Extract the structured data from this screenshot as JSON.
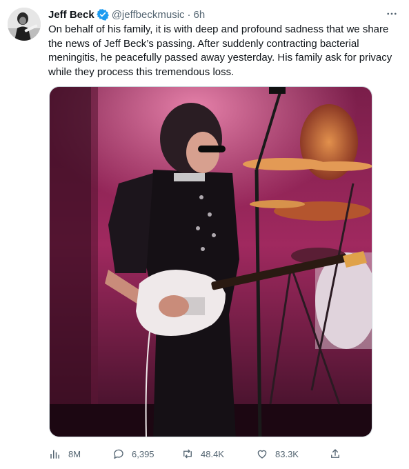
{
  "tweet": {
    "author_name": "Jeff Beck",
    "handle": "@jeffbeckmusic",
    "separator": "·",
    "time": "6h",
    "text": "On behalf of his family, it is with deep and profound sadness that we share the news of Jeff Beck’s passing. After suddenly contracting bacterial meningitis, he peacefully passed away yesterday. His family ask for privacy while they process this tremendous loss."
  },
  "icons": {
    "verified": "verified-badge-icon",
    "more": "more-options-icon",
    "views": "views-chart-icon",
    "reply": "reply-bubble-icon",
    "retweet": "retweet-icon",
    "like": "heart-icon",
    "share": "share-icon"
  },
  "actions": {
    "views": "8M",
    "replies": "6,395",
    "retweets": "48.4K",
    "likes": "83.3K"
  },
  "colors": {
    "verified": "#1d9bf0",
    "muted_text": "#536471",
    "stage_magenta": "#c2337a"
  }
}
